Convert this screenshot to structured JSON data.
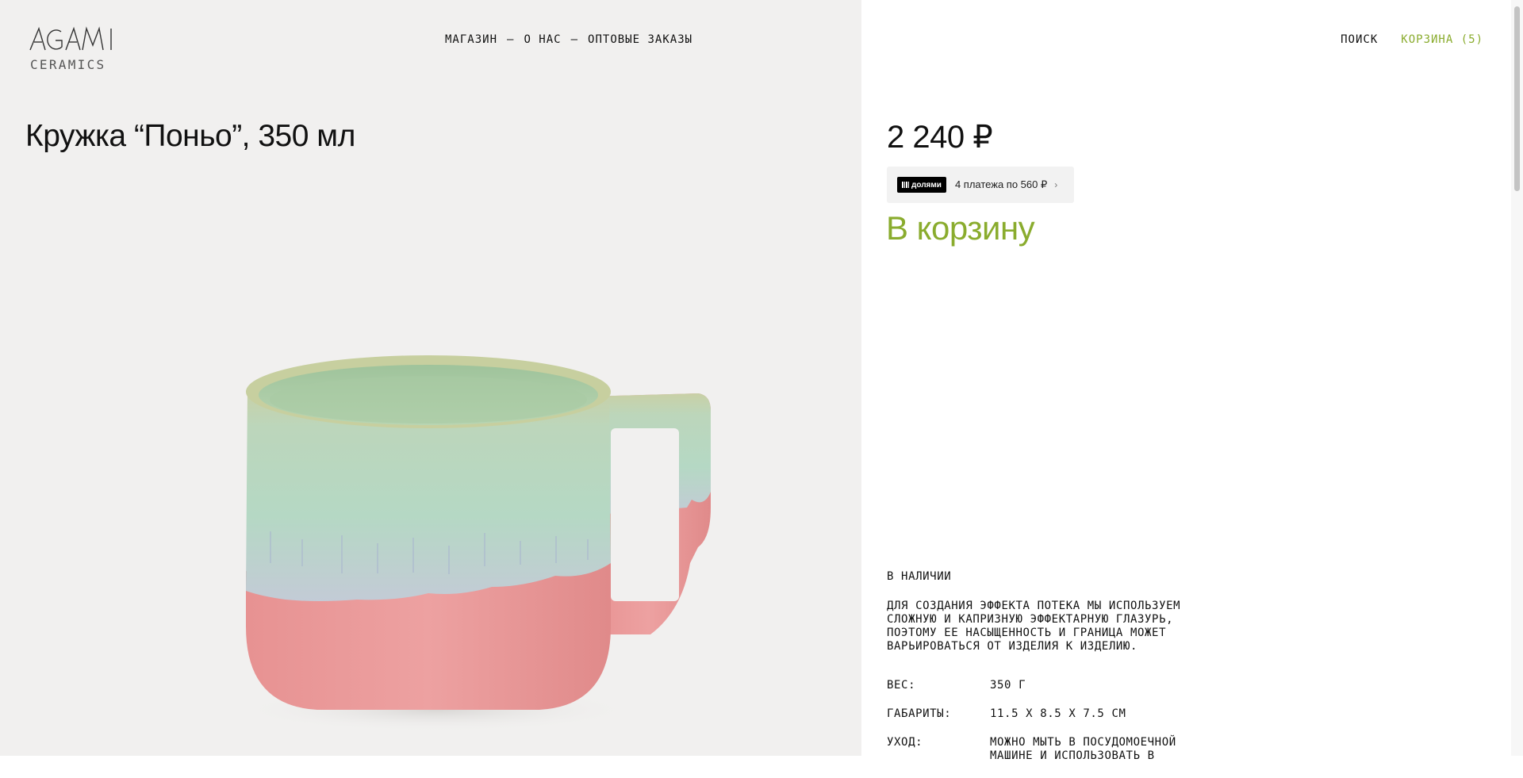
{
  "header": {
    "logo_word": "AGAMI",
    "logo_sub": "CERAMICS",
    "nav": [
      {
        "label": "МАГАЗИН"
      },
      {
        "label": "О НАС"
      },
      {
        "label": "ОПТОВЫЕ ЗАКАЗЫ"
      }
    ],
    "nav_separator": "—",
    "search_label": "ПОИСК",
    "cart_label": "КОРЗИНА (5)"
  },
  "product": {
    "title": "Кружка “Поньо”, 350 мл",
    "price": "2 240 ₽",
    "installments": {
      "badge": "долями",
      "text": "4 платежа по 560 ₽",
      "chevron_icon": "chevron-right-icon"
    },
    "add_to_cart_label": "В корзину",
    "availability": "В НАЛИЧИИ",
    "description": "ДЛЯ СОЗДАНИЯ ЭФФЕКТА ПОТЕКА МЫ ИСПОЛЬЗУЕМ СЛОЖНУЮ И КАПРИЗНУЮ ЭФФЕКТАРНУЮ ГЛАЗУРЬ, ПОЭТОМУ ЕЕ НАСЫЩЕННОСТЬ И ГРАНИЦА МОЖЕТ ВАРЬИРОВАТЬСЯ ОТ ИЗДЕЛИЯ К ИЗДЕЛИЮ.",
    "specs": [
      {
        "label": "ВЕС:",
        "value": "350 Г"
      },
      {
        "label": "ГАБАРИТЫ:",
        "value": "11.5 Х 8.5 Х 7.5 СМ"
      },
      {
        "label": "УХОД:",
        "value": "МОЖНО МЫТЬ В ПОСУДОМОЕЧНОЙ МАШИНЕ И ИСПОЛЬЗОВАТЬ В"
      }
    ]
  },
  "colors": {
    "accent": "#8aac2e",
    "left_bg": "#f1f0ef",
    "glaze_green": "#b9d3b6",
    "glaze_pink": "#e99a9a"
  }
}
